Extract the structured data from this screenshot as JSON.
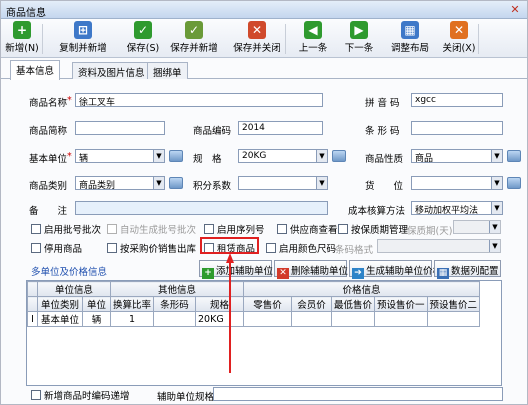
{
  "window": {
    "title": "商品信息"
  },
  "toolbar": [
    {
      "label": "新增(N)",
      "icon": "add-icon",
      "color": "#2f9a2f",
      "glyph": "+"
    },
    {
      "label": "复制并新增",
      "icon": "copy-add-icon",
      "color": "#3e78c8",
      "glyph": "⊞"
    },
    {
      "label": "保存(S)",
      "icon": "save-icon",
      "color": "#2f9a2f",
      "glyph": "✓"
    },
    {
      "label": "保存并新增",
      "icon": "save-add-icon",
      "color": "#6a9a38",
      "glyph": "✓"
    },
    {
      "label": "保存并关闭",
      "icon": "save-close-icon",
      "color": "#d04a2c",
      "glyph": "✕"
    },
    {
      "label": "上一条",
      "icon": "prev-icon",
      "color": "#2f9a2f",
      "glyph": "◀"
    },
    {
      "label": "下一条",
      "icon": "next-icon",
      "color": "#2f9a2f",
      "glyph": "▶"
    },
    {
      "label": "调整布局",
      "icon": "layout-icon",
      "color": "#3e78c8",
      "glyph": "▦"
    },
    {
      "label": "关闭(X)",
      "icon": "close-icon",
      "color": "#e07020",
      "glyph": "✕"
    }
  ],
  "tabs": [
    "基本信息",
    "资料及图片信息",
    "捆绑单"
  ],
  "form": {
    "name_label": "商品名称",
    "name_value": "徐工叉车",
    "pinyin_label": "拼 音 码",
    "pinyin_value": "xgcc",
    "short_label": "商品简称",
    "short_value": "",
    "code_label": "商品编码",
    "code_value": "2014",
    "barcode_label": "条 形 码",
    "barcode_value": "",
    "unit_label": "基本单位",
    "unit_value": "辆",
    "spec_label": "规　格",
    "spec_value": "20KG",
    "nature_label": "商品性质",
    "nature_value": "商品",
    "category_label": "商品类别",
    "category_value": "商品类别",
    "points_label": "积分系数",
    "points_value": "",
    "location_label": "货　　位",
    "location_value": "",
    "note_label": "备　　注",
    "note_value": "",
    "costing_label": "成本核算方法",
    "costing_value": "移动加权平均法",
    "shelf_unit_value": "保质期(天)",
    "barcode_format_label": "条码格式"
  },
  "checkboxes": {
    "batch": "启用批号批次",
    "auto_batch": "自动生成批号批次",
    "serial": "启用序列号",
    "supplier": "供应商查看",
    "shelf": "按保质期管理",
    "disable": "停用商品",
    "purchase_price": "按采购价销售出库",
    "rental": "租赁商品",
    "color_size": "启用颜色尺码"
  },
  "section": {
    "multi_unit": "多单位及价格信息"
  },
  "buttons": {
    "add_unit": "添加辅助单位",
    "del_unit": "删除辅助单位",
    "gen_unit": "生成辅助单位价格",
    "config": "数据列配置"
  },
  "grid": {
    "group_unit": "单位信息",
    "group_other": "其他信息",
    "group_price": "价格信息",
    "columns": [
      "单位类别",
      "单位",
      "换算比率",
      "条形码",
      "规格",
      "零售价",
      "会员价",
      "最低售价",
      "预设售价一",
      "预设售价二"
    ],
    "rows": [
      {
        "marker": "I",
        "type": "基本单位",
        "unit": "辆",
        "ratio": "1",
        "barcode": "",
        "spec": "20KG"
      }
    ]
  },
  "bottom": {
    "auto_code": "新增商品时编码递增",
    "aux_spec": "辅助单位规格"
  }
}
